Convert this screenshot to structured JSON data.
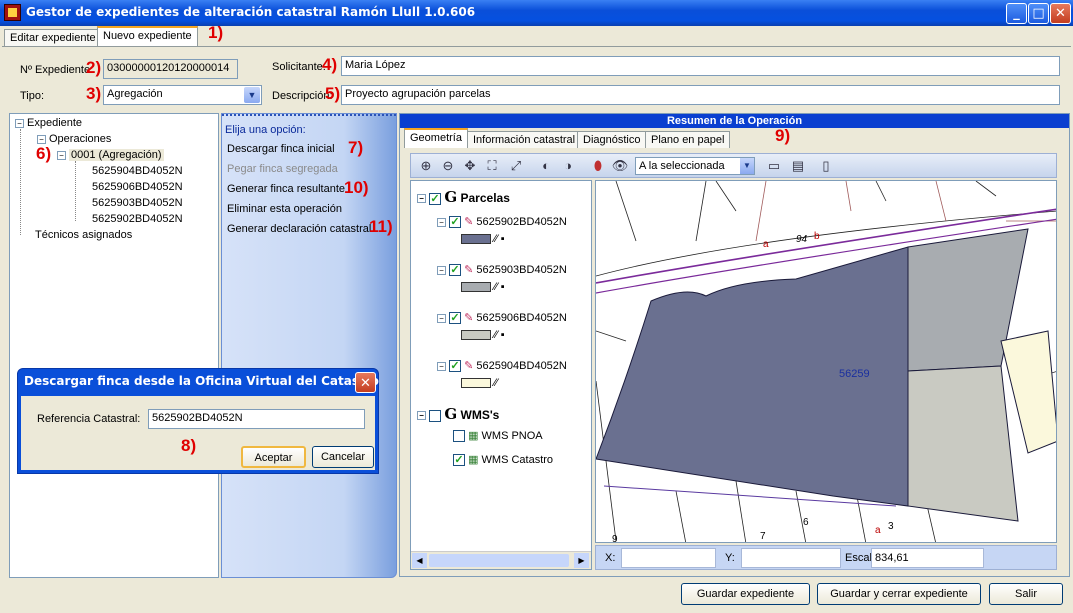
{
  "window": {
    "title": "Gestor de expedientes de alteración catastral Ramón Llull 1.0.606",
    "min": "_",
    "max": "□",
    "close": "✕"
  },
  "tabs": [
    {
      "label": "Editar expediente"
    },
    {
      "label": "Nuevo expediente"
    }
  ],
  "annotations": {
    "a1": "1)",
    "a2": "2)",
    "a3": "3)",
    "a4": "4)",
    "a5": "5)",
    "a6": "6)",
    "a7": "7)",
    "a8": "8)",
    "a9": "9)",
    "a10": "10)",
    "a11": "11)"
  },
  "form": {
    "expediente_label": "Nº Expediente:",
    "expediente_value": "03000000120120000014",
    "tipo_label": "Tipo:",
    "tipo_value": "Agregación",
    "solicitante_label": "Solicitante:",
    "solicitante_value": "Maria López",
    "descripcion_label": "Descripción:",
    "descripcion_value": "Proyecto agrupación parcelas"
  },
  "tree": {
    "root": "Expediente",
    "operaciones": "Operaciones",
    "operation": "0001 (Agregación)",
    "parcels": [
      "5625904BD4052N",
      "5625906BD4052N",
      "5625903BD4052N",
      "5625902BD4052N"
    ],
    "tecnicos": "Técnicos asignados"
  },
  "options": {
    "header": "Elija una opción:",
    "items": [
      {
        "label": "Descargar finca inicial",
        "enabled": true
      },
      {
        "label": "Pegar finca segregada",
        "enabled": false
      },
      {
        "label": "Generar finca resultante",
        "enabled": true
      },
      {
        "label": "Eliminar esta operación",
        "enabled": true
      },
      {
        "label": "Generar declaración catastral",
        "enabled": true
      }
    ]
  },
  "resumen": {
    "title": "Resumen de la Operación",
    "tabs": [
      "Geometría",
      "Información catastral",
      "Diagnóstico",
      "Plano en papel"
    ],
    "selection_combo": "A la seleccionada"
  },
  "layers": {
    "parcelas_label": "Parcelas",
    "parcelas": [
      {
        "name": "5625902BD4052N",
        "color": "#6a7090"
      },
      {
        "name": "5625903BD4052N",
        "color": "#a8acb0"
      },
      {
        "name": "5625906BD4052N",
        "color": "#c9cac2"
      },
      {
        "name": "5625904BD4052N",
        "color": "#fbf8dc"
      }
    ],
    "wms_label": "WMS's",
    "wms": [
      {
        "name": "WMS PNOA",
        "checked": false
      },
      {
        "name": "WMS Catastro",
        "checked": true
      }
    ]
  },
  "map": {
    "parcel_label": "56259",
    "labels": [
      "94",
      "b",
      "a",
      "9",
      "7",
      "6",
      "3",
      "a"
    ],
    "x_label": "X:",
    "y_label": "Y:",
    "x_value": "",
    "y_value": "",
    "escala_label": "Escala:",
    "escala_value": "834,61"
  },
  "dialog": {
    "title": "Descargar finca desde la Oficina Virtual del Catastro",
    "ref_label": "Referencia Catastral:",
    "ref_value": "5625902BD4052N",
    "accept": "Aceptar",
    "cancel": "Cancelar"
  },
  "footer": {
    "save": "Guardar expediente",
    "save_close": "Guardar y cerrar expediente",
    "exit": "Salir"
  }
}
